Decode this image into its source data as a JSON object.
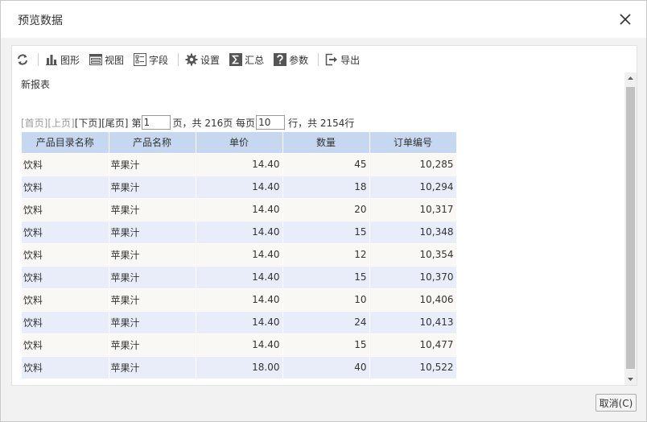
{
  "dialog": {
    "title": "预览数据",
    "cancel_label": "取消(C)"
  },
  "toolbar": {
    "items": [
      {
        "label": "图形",
        "icon": "bar-chart-icon"
      },
      {
        "label": "视图",
        "icon": "view-icon"
      },
      {
        "label": "字段",
        "icon": "field-icon"
      },
      {
        "label": "设置",
        "icon": "gear-icon"
      },
      {
        "label": "汇总",
        "icon": "sum-icon"
      },
      {
        "label": "参数",
        "icon": "question-icon"
      },
      {
        "label": "导出",
        "icon": "export-icon"
      }
    ]
  },
  "report": {
    "title": "新报表"
  },
  "pager": {
    "first": "[首页]",
    "prev": "[上页]",
    "next": "[下页]",
    "last": "[尾页]",
    "page_prefix": "第",
    "page_value": "1",
    "page_suffix": "页，共 216页 每页",
    "size_value": "10",
    "size_suffix": "行，共 2154行"
  },
  "table": {
    "headers": [
      "产品目录名称",
      "产品名称",
      "单价",
      "数量",
      "订单编号"
    ],
    "rows": [
      [
        "饮料",
        "苹果汁",
        "14.40",
        "45",
        "10,285"
      ],
      [
        "饮料",
        "苹果汁",
        "14.40",
        "18",
        "10,294"
      ],
      [
        "饮料",
        "苹果汁",
        "14.40",
        "20",
        "10,317"
      ],
      [
        "饮料",
        "苹果汁",
        "14.40",
        "15",
        "10,348"
      ],
      [
        "饮料",
        "苹果汁",
        "14.40",
        "12",
        "10,354"
      ],
      [
        "饮料",
        "苹果汁",
        "14.40",
        "15",
        "10,370"
      ],
      [
        "饮料",
        "苹果汁",
        "14.40",
        "10",
        "10,406"
      ],
      [
        "饮料",
        "苹果汁",
        "14.40",
        "24",
        "10,413"
      ],
      [
        "饮料",
        "苹果汁",
        "14.40",
        "15",
        "10,477"
      ],
      [
        "饮料",
        "苹果汁",
        "18.00",
        "40",
        "10,522"
      ]
    ]
  },
  "colors": {
    "header_bg": "#c6d8ef",
    "row_odd": "#f9f8f4",
    "row_even": "#e9edfa",
    "icon": "#555555"
  }
}
